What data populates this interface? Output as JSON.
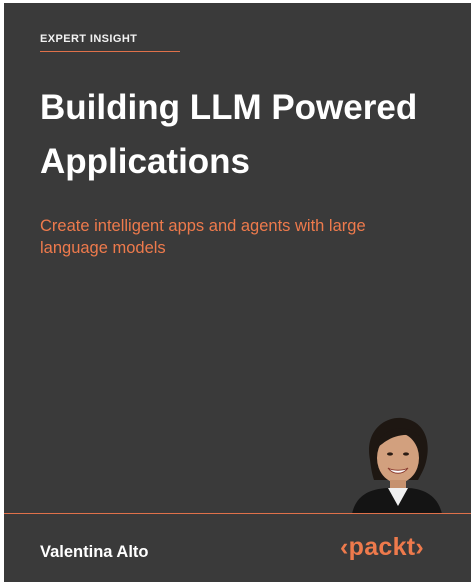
{
  "cover": {
    "series_label": "EXPERT INSIGHT",
    "title": "Building LLM Powered Applications",
    "subtitle": "Create intelligent apps and agents with large language models",
    "author": "Valentina Alto",
    "publisher_logo": "‹packt›",
    "colors": {
      "background": "#3a3a3a",
      "accent": "#ee7a4c",
      "title": "#ffffff",
      "wave_light": "#d9d9d9"
    }
  }
}
